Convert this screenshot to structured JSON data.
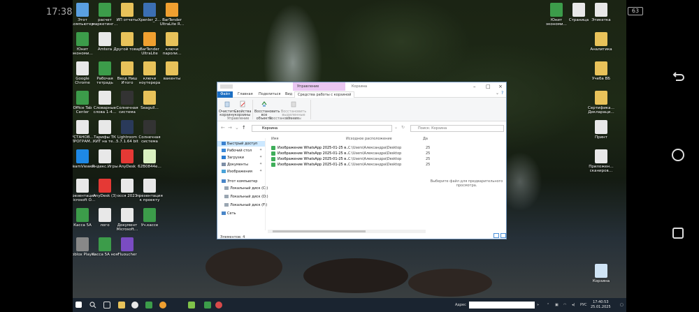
{
  "android": {
    "time": "17:38",
    "battery": "63"
  },
  "desktop_left": [
    {
      "label": "Этот компьютер",
      "color": "#5aa0e0"
    },
    {
      "label": "расчет маркетинг…",
      "color": "#3c9c4a"
    },
    {
      "label": "ИП отчеты",
      "color": "#e8c25a"
    },
    {
      "label": "Xpenler_2…",
      "color": "#3b6fb3"
    },
    {
      "label": "BarTender UltraLite R…",
      "color": "#f0a030"
    },
    {
      "label": "Юнит экономи…",
      "color": "#3c9c4a"
    },
    {
      "label": "Amtera",
      "color": "#e8e8e8"
    },
    {
      "label": "Другой товар",
      "color": "#e8c25a"
    },
    {
      "label": "BarTender UltraLite",
      "color": "#f0a030"
    },
    {
      "label": "ключи пароли…",
      "color": "#e8c25a"
    },
    {
      "label": "Google Chrome",
      "color": "#e8e8e8"
    },
    {
      "label": "Рабочая тетрадь",
      "color": "#3c9c4a"
    },
    {
      "label": "Ввод Ниш Итого",
      "color": "#e8c25a"
    },
    {
      "label": "ключи ноутерера",
      "color": "#e8c25a"
    },
    {
      "label": "вакенты",
      "color": "#e8c25a"
    },
    {
      "label": "Office Tab Center",
      "color": "#3c9c4a"
    },
    {
      "label": "Словарные слова 1-4…",
      "color": "#e8e8e8"
    },
    {
      "label": "Солнечная система",
      "color": "#333"
    },
    {
      "label": "Seagull…",
      "color": "#e8c25a"
    },
    {
      "label": "",
      "color": "#333"
    },
    {
      "label": "УСТАНОВ… ПРОГРАМ…",
      "color": "#e8e8e8"
    },
    {
      "label": "Тарифы ТК КИТ на те…",
      "color": "#e8e8e8"
    },
    {
      "label": "Lightroom 5.7.1.64 bit",
      "color": "#2a3a5a"
    },
    {
      "label": "Солнечная система",
      "color": "#333"
    },
    {
      "label": "",
      "color": "#333"
    },
    {
      "label": "TeamViewer",
      "color": "#1e88e5"
    },
    {
      "label": "Яндекс.Игры",
      "color": "#e8e8e8"
    },
    {
      "label": "AnyDesk",
      "color": "#e53935"
    },
    {
      "label": "62B0844e…",
      "color": "#d9f0c0"
    },
    {
      "label": "",
      "color": "#333"
    },
    {
      "label": "Презентация Microsoft O…",
      "color": "#e8e8e8"
    },
    {
      "label": "AnyDesk (3)",
      "color": "#e53935"
    },
    {
      "label": "осся 2023",
      "color": "#e8e8e8"
    },
    {
      "label": "презентация к проекту",
      "color": "#e8e8e8"
    },
    {
      "label": "",
      "color": "#333"
    },
    {
      "label": "Касса 5А",
      "color": "#3c9c4a"
    },
    {
      "label": "лого",
      "color": "#e8e8e8"
    },
    {
      "label": "Документ Microsoft…",
      "color": "#e8e8e8"
    },
    {
      "label": "Уч.кассе",
      "color": "#3c9c4a"
    },
    {
      "label": "",
      "color": "#333"
    },
    {
      "label": "Roblox Player",
      "color": "#888"
    },
    {
      "label": "Касса 5А ноя",
      "color": "#3c9c4a"
    },
    {
      "label": "Fluoucher",
      "color": "#7a4cc2"
    }
  ],
  "desktop_right": [
    {
      "label": "Юнит экономи…",
      "color": "#3c9c4a"
    },
    {
      "label": "Страница",
      "color": "#e8e8e8"
    },
    {
      "label": "Этикетка",
      "color": "#e8e8e8"
    },
    {
      "label": "Аналитика",
      "color": "#e8c25a"
    },
    {
      "label": "Учеба ВБ",
      "color": "#e8c25a"
    },
    {
      "label": "Сертифика… Деклараци…",
      "color": "#e8c25a"
    },
    {
      "label": "Принт",
      "color": "#e8e8e8"
    },
    {
      "label": "Приложен… сканиров…",
      "color": "#e8e8e8"
    },
    {
      "label": "Корзина",
      "color": "#cfe4f5"
    }
  ],
  "explorer": {
    "context_tab": "Управление",
    "title": "Корзина",
    "ribbon_tabs": {
      "file": "Файл",
      "home": "Главная",
      "share": "Поделиться",
      "view": "Вид",
      "tools": "Средства работы с корзиной"
    },
    "ribbon": {
      "empty_bin": "Очистить корзину",
      "properties": "Свойства корзины",
      "group_manage": "Управление",
      "restore_all": "Восстановить все объекты",
      "restore_selected": "Восстановить выделенные объекты",
      "group_restore": "Восстановление"
    },
    "address": "Корзина",
    "search_placeholder": "Поиск: Корзина",
    "nav": {
      "quick_access": "Быстрый доступ",
      "desktop": "Рабочий стол",
      "downloads": "Загрузки",
      "documents": "Документы",
      "images": "Изображения",
      "this_pc": "Этот компьютер",
      "disk_c": "Локальный диск (C:)",
      "disk_d": "Локальный диск (D:)",
      "disk_f": "Локальный диск (F:)",
      "network": "Сеть"
    },
    "columns": {
      "name": "Имя",
      "location": "Исходное расположение",
      "date": "Да"
    },
    "files": [
      {
        "name": "Изображение WhatsApp 2025-01-25 в…",
        "location": "C:\\Users\\Александра\\Desktop",
        "date": "25"
      },
      {
        "name": "Изображение WhatsApp 2025-01-25 в…",
        "location": "C:\\Users\\Александра\\Desktop",
        "date": "25"
      },
      {
        "name": "Изображение WhatsApp 2025-01-25 в…",
        "location": "C:\\Users\\Александра\\Desktop",
        "date": "25"
      },
      {
        "name": "Изображение WhatsApp 2025-01-25 в…",
        "location": "C:\\Users\\Александра\\Desktop",
        "date": "25"
      }
    ],
    "preview_text": "Выберите файл для предварительного просмотра.",
    "status": "Элементов: 4"
  },
  "taskbar": {
    "address_label": "Адрес",
    "lang": "РУС",
    "time": "17:40:53",
    "date": "25.01.2025"
  }
}
